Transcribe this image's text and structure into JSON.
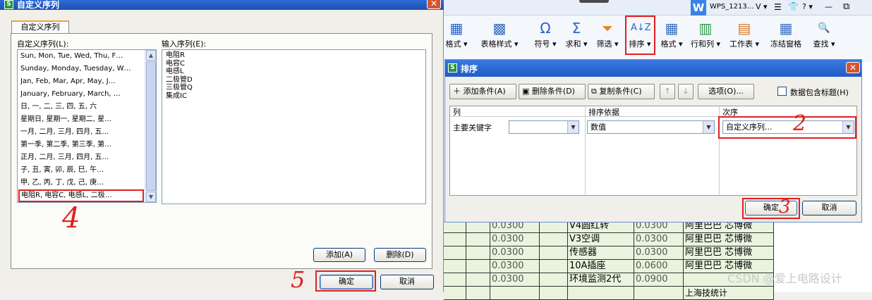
{
  "dialog1": {
    "title": "自定义序列",
    "tab": "自定义序列",
    "list_label": "自定义序列(L):",
    "input_label": "输入序列(E):",
    "list_items": [
      "Sun, Mon, Tue, Wed, Thu, F…",
      "Sunday, Monday, Tuesday, W…",
      "Jan, Feb, Mar, Apr, May, J…",
      "January, February, March, …",
      "日, 一, 二, 三, 四, 五, 六",
      "星期日, 星期一, 星期二, 星…",
      "一月, 二月, 三月, 四月, 五…",
      "第一季, 第二季, 第三季, 第…",
      "正月, 二月, 三月, 四月, 五…",
      "子, 丑, 寅, 卯, 辰, 巳, 午…",
      "甲, 乙, 丙, 丁, 戊, 己, 庚…"
    ],
    "selected_item": "电阻R, 电容C, 电感L, 二极…",
    "input_lines": [
      "电阻R",
      "电容C",
      "电感L",
      "二极管D",
      "三极管Q",
      "集成IC"
    ],
    "add_button": "添加(A)",
    "delete_button": "删除(D)",
    "ok_button": "确定",
    "cancel_button": "取消",
    "annotation_4": "4",
    "annotation_5": "5"
  },
  "titlebar": {
    "app_tab": "WPS_1213…"
  },
  "ribbon": {
    "items": [
      "格式",
      "表格样式",
      "符号",
      "求和",
      "筛选",
      "排序",
      "格式",
      "行和列",
      "工作表",
      "冻结窗格",
      "查找"
    ]
  },
  "dialog2": {
    "title": "排序",
    "add_condition": "添加条件(A)",
    "delete_condition": "删除条件(D)",
    "copy_condition": "复制条件(C)",
    "options": "选项(O)...",
    "header_checkbox": "数据包含标题(H)",
    "col_header": "列",
    "basis_header": "排序依据",
    "order_header": "次序",
    "row_label": "主要关键字",
    "basis_value": "数值",
    "order_value": "自定义序列...",
    "ok_button": "确定",
    "cancel_button": "取消",
    "annotation_2": "2",
    "annotation_3": "3"
  },
  "sheet_rows": [
    {
      "a": "0.0300",
      "b": "V4圆红转",
      "c": "0.0300",
      "d": "阿里巴巴 芯博微"
    },
    {
      "a": "0.0300",
      "b": "V3空调",
      "c": "0.0300",
      "d": "阿里巴巴 芯博微"
    },
    {
      "a": "0.0300",
      "b": "传感器",
      "c": "0.0300",
      "d": "阿里巴巴 芯博微"
    },
    {
      "a": "0.0300",
      "b": "10A插座",
      "c": "0.0600",
      "d": "阿里巴巴 芯博微"
    },
    {
      "a": "0.0300",
      "b": "环境监测2代",
      "c": "0.0900",
      "d": ""
    },
    {
      "a": "",
      "b": "",
      "c": "",
      "d": "上海技统计"
    }
  ],
  "watermark": "CSDN @爱上电路设计"
}
